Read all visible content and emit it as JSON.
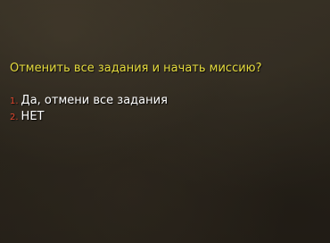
{
  "dialog": {
    "question": "Отменить все задания и начать миссию?",
    "options": [
      {
        "number": "1.",
        "label": "Да, отмени все задания"
      },
      {
        "number": "2.",
        "label": "НЕТ"
      }
    ]
  },
  "colors": {
    "question_text": "#e6dc3e",
    "option_text": "#ffffff",
    "option_number": "#e0462e"
  }
}
